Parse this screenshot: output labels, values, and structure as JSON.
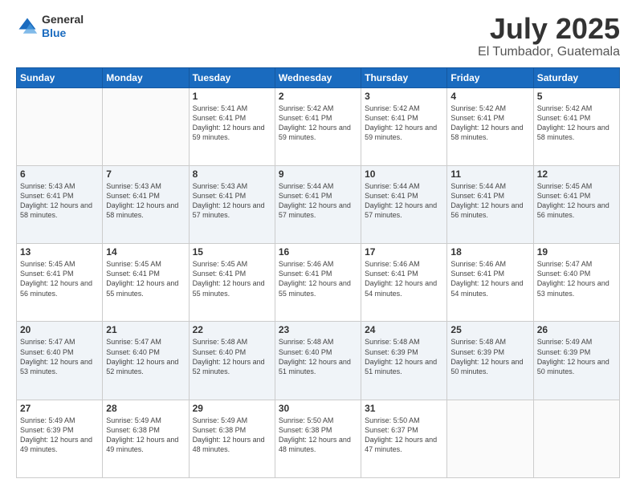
{
  "logo": {
    "line1": "General",
    "line2": "Blue"
  },
  "title": {
    "month_year": "July 2025",
    "location": "El Tumbador, Guatemala"
  },
  "days_of_week": [
    "Sunday",
    "Monday",
    "Tuesday",
    "Wednesday",
    "Thursday",
    "Friday",
    "Saturday"
  ],
  "weeks": [
    [
      {
        "day": "",
        "sunrise": "",
        "sunset": "",
        "daylight": ""
      },
      {
        "day": "",
        "sunrise": "",
        "sunset": "",
        "daylight": ""
      },
      {
        "day": "1",
        "sunrise": "Sunrise: 5:41 AM",
        "sunset": "Sunset: 6:41 PM",
        "daylight": "Daylight: 12 hours and 59 minutes."
      },
      {
        "day": "2",
        "sunrise": "Sunrise: 5:42 AM",
        "sunset": "Sunset: 6:41 PM",
        "daylight": "Daylight: 12 hours and 59 minutes."
      },
      {
        "day": "3",
        "sunrise": "Sunrise: 5:42 AM",
        "sunset": "Sunset: 6:41 PM",
        "daylight": "Daylight: 12 hours and 59 minutes."
      },
      {
        "day": "4",
        "sunrise": "Sunrise: 5:42 AM",
        "sunset": "Sunset: 6:41 PM",
        "daylight": "Daylight: 12 hours and 58 minutes."
      },
      {
        "day": "5",
        "sunrise": "Sunrise: 5:42 AM",
        "sunset": "Sunset: 6:41 PM",
        "daylight": "Daylight: 12 hours and 58 minutes."
      }
    ],
    [
      {
        "day": "6",
        "sunrise": "Sunrise: 5:43 AM",
        "sunset": "Sunset: 6:41 PM",
        "daylight": "Daylight: 12 hours and 58 minutes."
      },
      {
        "day": "7",
        "sunrise": "Sunrise: 5:43 AM",
        "sunset": "Sunset: 6:41 PM",
        "daylight": "Daylight: 12 hours and 58 minutes."
      },
      {
        "day": "8",
        "sunrise": "Sunrise: 5:43 AM",
        "sunset": "Sunset: 6:41 PM",
        "daylight": "Daylight: 12 hours and 57 minutes."
      },
      {
        "day": "9",
        "sunrise": "Sunrise: 5:44 AM",
        "sunset": "Sunset: 6:41 PM",
        "daylight": "Daylight: 12 hours and 57 minutes."
      },
      {
        "day": "10",
        "sunrise": "Sunrise: 5:44 AM",
        "sunset": "Sunset: 6:41 PM",
        "daylight": "Daylight: 12 hours and 57 minutes."
      },
      {
        "day": "11",
        "sunrise": "Sunrise: 5:44 AM",
        "sunset": "Sunset: 6:41 PM",
        "daylight": "Daylight: 12 hours and 56 minutes."
      },
      {
        "day": "12",
        "sunrise": "Sunrise: 5:45 AM",
        "sunset": "Sunset: 6:41 PM",
        "daylight": "Daylight: 12 hours and 56 minutes."
      }
    ],
    [
      {
        "day": "13",
        "sunrise": "Sunrise: 5:45 AM",
        "sunset": "Sunset: 6:41 PM",
        "daylight": "Daylight: 12 hours and 56 minutes."
      },
      {
        "day": "14",
        "sunrise": "Sunrise: 5:45 AM",
        "sunset": "Sunset: 6:41 PM",
        "daylight": "Daylight: 12 hours and 55 minutes."
      },
      {
        "day": "15",
        "sunrise": "Sunrise: 5:45 AM",
        "sunset": "Sunset: 6:41 PM",
        "daylight": "Daylight: 12 hours and 55 minutes."
      },
      {
        "day": "16",
        "sunrise": "Sunrise: 5:46 AM",
        "sunset": "Sunset: 6:41 PM",
        "daylight": "Daylight: 12 hours and 55 minutes."
      },
      {
        "day": "17",
        "sunrise": "Sunrise: 5:46 AM",
        "sunset": "Sunset: 6:41 PM",
        "daylight": "Daylight: 12 hours and 54 minutes."
      },
      {
        "day": "18",
        "sunrise": "Sunrise: 5:46 AM",
        "sunset": "Sunset: 6:41 PM",
        "daylight": "Daylight: 12 hours and 54 minutes."
      },
      {
        "day": "19",
        "sunrise": "Sunrise: 5:47 AM",
        "sunset": "Sunset: 6:40 PM",
        "daylight": "Daylight: 12 hours and 53 minutes."
      }
    ],
    [
      {
        "day": "20",
        "sunrise": "Sunrise: 5:47 AM",
        "sunset": "Sunset: 6:40 PM",
        "daylight": "Daylight: 12 hours and 53 minutes."
      },
      {
        "day": "21",
        "sunrise": "Sunrise: 5:47 AM",
        "sunset": "Sunset: 6:40 PM",
        "daylight": "Daylight: 12 hours and 52 minutes."
      },
      {
        "day": "22",
        "sunrise": "Sunrise: 5:48 AM",
        "sunset": "Sunset: 6:40 PM",
        "daylight": "Daylight: 12 hours and 52 minutes."
      },
      {
        "day": "23",
        "sunrise": "Sunrise: 5:48 AM",
        "sunset": "Sunset: 6:40 PM",
        "daylight": "Daylight: 12 hours and 51 minutes."
      },
      {
        "day": "24",
        "sunrise": "Sunrise: 5:48 AM",
        "sunset": "Sunset: 6:39 PM",
        "daylight": "Daylight: 12 hours and 51 minutes."
      },
      {
        "day": "25",
        "sunrise": "Sunrise: 5:48 AM",
        "sunset": "Sunset: 6:39 PM",
        "daylight": "Daylight: 12 hours and 50 minutes."
      },
      {
        "day": "26",
        "sunrise": "Sunrise: 5:49 AM",
        "sunset": "Sunset: 6:39 PM",
        "daylight": "Daylight: 12 hours and 50 minutes."
      }
    ],
    [
      {
        "day": "27",
        "sunrise": "Sunrise: 5:49 AM",
        "sunset": "Sunset: 6:39 PM",
        "daylight": "Daylight: 12 hours and 49 minutes."
      },
      {
        "day": "28",
        "sunrise": "Sunrise: 5:49 AM",
        "sunset": "Sunset: 6:38 PM",
        "daylight": "Daylight: 12 hours and 49 minutes."
      },
      {
        "day": "29",
        "sunrise": "Sunrise: 5:49 AM",
        "sunset": "Sunset: 6:38 PM",
        "daylight": "Daylight: 12 hours and 48 minutes."
      },
      {
        "day": "30",
        "sunrise": "Sunrise: 5:50 AM",
        "sunset": "Sunset: 6:38 PM",
        "daylight": "Daylight: 12 hours and 48 minutes."
      },
      {
        "day": "31",
        "sunrise": "Sunrise: 5:50 AM",
        "sunset": "Sunset: 6:37 PM",
        "daylight": "Daylight: 12 hours and 47 minutes."
      },
      {
        "day": "",
        "sunrise": "",
        "sunset": "",
        "daylight": ""
      },
      {
        "day": "",
        "sunrise": "",
        "sunset": "",
        "daylight": ""
      }
    ]
  ]
}
